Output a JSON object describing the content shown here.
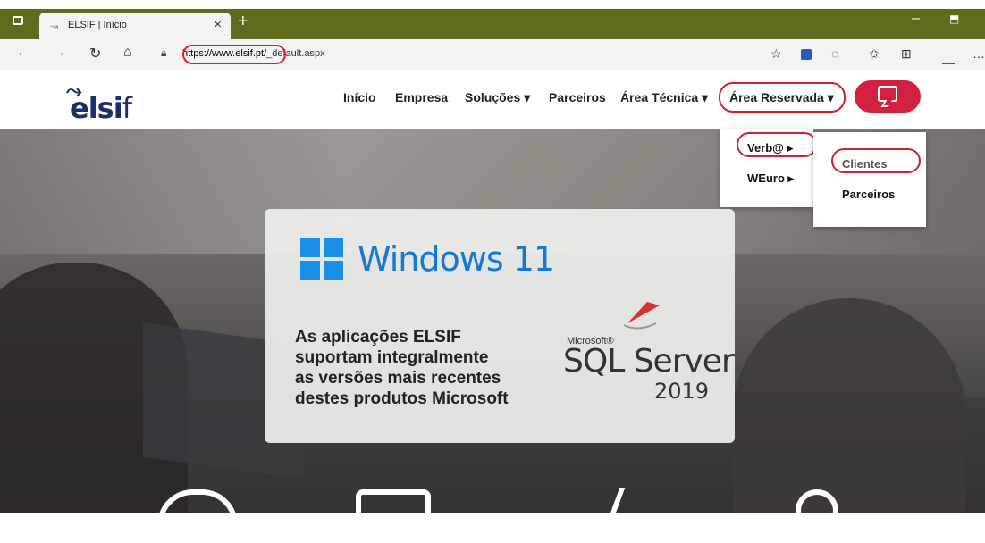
{
  "browser": {
    "tab_title": "ELSIF | Início",
    "tab_close": "×",
    "new_tab": "+",
    "url_host": "https://www.elsif.pt/",
    "url_path": "_default.aspx",
    "window_min": "–",
    "window_restore": "⬒"
  },
  "site": {
    "logo_text": "elsi",
    "logo_f": "f",
    "nav": [
      "Início",
      "Empresa",
      "Soluções ▾",
      "Parceiros",
      "Área Técnica ▾",
      "Área Reservada ▾"
    ],
    "submenu": [
      "Verb@ ▸",
      "WEuro ▸"
    ],
    "submenu2": [
      "Clientes",
      "Parceiros"
    ]
  },
  "promo": {
    "windows_text": "Windows 11",
    "lines": [
      "As aplicações ELSIF",
      "suportam integralmente",
      "as versões mais recentes",
      "destes produtos Microsoft"
    ],
    "sql_microsoft": "Microsoft®",
    "sql_name": "SQL Server",
    "sql_version": "2019"
  },
  "colors": {
    "accent_red": "#d3203e",
    "highlight_ring": "#d3202a",
    "windows_blue": "#1478d4"
  }
}
